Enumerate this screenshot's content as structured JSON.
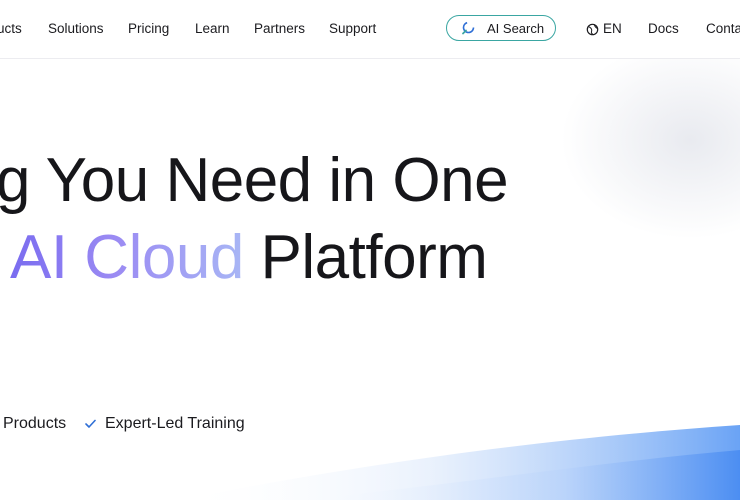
{
  "nav": {
    "items": [
      "ucts",
      "Solutions",
      "Pricing",
      "Learn",
      "Partners",
      "Support"
    ],
    "ai_search_label": "AI Search",
    "language_label": "EN",
    "docs_label": "Docs",
    "contact_label": "Conta"
  },
  "hero": {
    "line1": "g You Need in One",
    "line2_accent": "AI Cloud",
    "line2_rest": " Platform"
  },
  "features": [
    {
      "label": "Products"
    },
    {
      "label": "Expert-Led Training"
    }
  ],
  "colors": {
    "accent_gradient_start": "#7a6cf0",
    "accent_gradient_end": "#a8b6f5",
    "search_border": "#3aa6a2",
    "check_color": "#2f6fd6",
    "wave_color": "#6aa3f5"
  },
  "icons": {
    "ai_search": "ai-search-icon",
    "language": "globe-icon",
    "check": "check-icon"
  }
}
